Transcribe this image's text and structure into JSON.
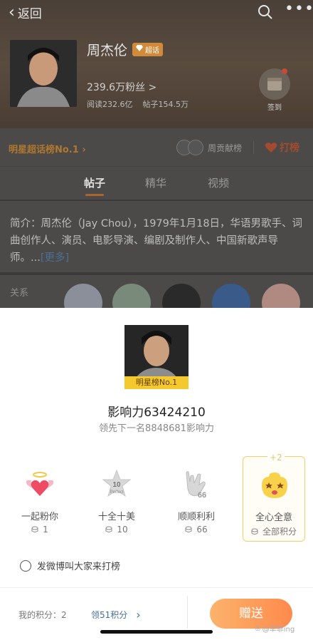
{
  "nav": {
    "back_label": "返回"
  },
  "profile": {
    "name": "周杰伦",
    "super_badge": "超话",
    "fans": "239.6万粉丝 >",
    "reads": "阅读232.6亿",
    "posts": "帖子154.5万",
    "checkin_label": "签到"
  },
  "rank_bar": {
    "rank_text": "明星超话榜No.1 ›",
    "contrib_label": "周贡献榜",
    "daban_label": "打榜"
  },
  "tabs": [
    "帖子",
    "精华",
    "视频"
  ],
  "intro": {
    "text": "简介：周杰伦（Jay Chou），1979年1月18日，华语男歌手、词曲创作人、演员、电影导演、编剧及制作人、中国新歌声导师。...",
    "more": "[更多]"
  },
  "relations": {
    "label": "关系"
  },
  "sheet": {
    "rank_badge": "明星榜No.1",
    "influence": "影响力63424210",
    "lead": "领先下一名8848681影响力",
    "gifts": [
      {
        "name": "一起粉你",
        "cost": "1",
        "icon": "heart-with-wings-icon"
      },
      {
        "name": "十全十美",
        "cost": "10",
        "icon": "perfect-10-star-icon"
      },
      {
        "name": "顺顺利利",
        "cost": "66",
        "icon": "rock-hand-66-icon"
      },
      {
        "name": "全心全意",
        "cost": "全部积分",
        "icon": "star-eyes-emoji-icon",
        "bonus": "+2"
      }
    ],
    "share_label": "发微博叫大家来打榜",
    "my_points": "我的积分：2",
    "earn_points": "领51积分",
    "send_label": "赠送",
    "watermark": "@芈菲ing"
  },
  "colors": {
    "accent": "#ff8a4c",
    "rank_gold": "#f5c92e",
    "link_blue": "#466f98"
  }
}
